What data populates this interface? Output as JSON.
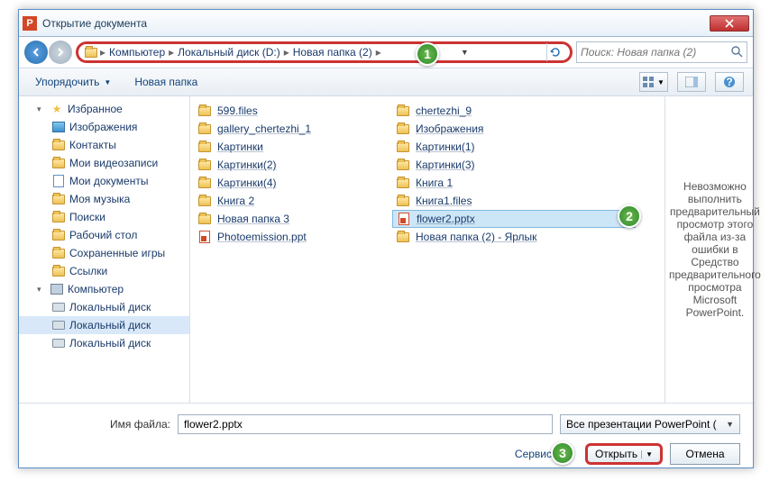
{
  "title": "Открытие документа",
  "breadcrumbs": [
    "Компьютер",
    "Локальный диск (D:)",
    "Новая папка (2)"
  ],
  "search_placeholder": "Поиск: Новая папка (2)",
  "toolbar": {
    "organize": "Упорядочить",
    "newfolder": "Новая папка"
  },
  "sidebar": [
    {
      "icon": "star",
      "label": "Избранное",
      "lvl": 1,
      "chev": "▾"
    },
    {
      "icon": "img",
      "label": "Изображения",
      "lvl": 2
    },
    {
      "icon": "folder",
      "label": "Контакты",
      "lvl": 2
    },
    {
      "icon": "folder",
      "label": "Мои видеозаписи",
      "lvl": 2
    },
    {
      "icon": "doc",
      "label": "Мои документы",
      "lvl": 2
    },
    {
      "icon": "folder",
      "label": "Моя музыка",
      "lvl": 2
    },
    {
      "icon": "folder",
      "label": "Поиски",
      "lvl": 2
    },
    {
      "icon": "folder",
      "label": "Рабочий стол",
      "lvl": 2
    },
    {
      "icon": "folder",
      "label": "Сохраненные игры",
      "lvl": 2
    },
    {
      "icon": "folder",
      "label": "Ссылки",
      "lvl": 2
    },
    {
      "icon": "comp",
      "label": "Компьютер",
      "lvl": 1,
      "chev": "▾"
    },
    {
      "icon": "drive",
      "label": "Локальный диск",
      "lvl": 2
    },
    {
      "icon": "drive",
      "label": "Локальный диск",
      "lvl": 2,
      "sel": true
    },
    {
      "icon": "drive",
      "label": "Локальный диск",
      "lvl": 2
    }
  ],
  "files_col1": [
    {
      "icon": "folder",
      "name": "599.files"
    },
    {
      "icon": "folder",
      "name": "gallery_chertezhi_1"
    },
    {
      "icon": "folder",
      "name": "Картинки"
    },
    {
      "icon": "folder",
      "name": "Картинки(2)"
    },
    {
      "icon": "folder",
      "name": "Картинки(4)"
    },
    {
      "icon": "folder",
      "name": "Книга 2"
    },
    {
      "icon": "folder",
      "name": "Новая папка 3"
    },
    {
      "icon": "ppt",
      "name": "Photoemission.ppt"
    }
  ],
  "files_col2": [
    {
      "icon": "folder",
      "name": "chertezhi_9"
    },
    {
      "icon": "folder",
      "name": "Изображения"
    },
    {
      "icon": "folder",
      "name": "Картинки(1)"
    },
    {
      "icon": "folder",
      "name": "Картинки(3)"
    },
    {
      "icon": "folder",
      "name": "Книга 1"
    },
    {
      "icon": "folder",
      "name": "Книга1.files"
    },
    {
      "icon": "ppt",
      "name": "flower2.pptx",
      "sel": true
    },
    {
      "icon": "folder",
      "name": "Новая папка (2) - Ярлык"
    }
  ],
  "preview_text": "Невозможно выполнить предварительный просмотр этого файла из-за ошибки в Средство предварительного просмотра Microsoft PowerPoint.",
  "footer": {
    "filename_label": "Имя файла:",
    "filename_value": "flower2.pptx",
    "filter": "Все презентации PowerPoint (",
    "tools": "Сервис",
    "open": "Открыть",
    "cancel": "Отмена"
  },
  "badges": {
    "1": "1",
    "2": "2",
    "3": "3"
  }
}
